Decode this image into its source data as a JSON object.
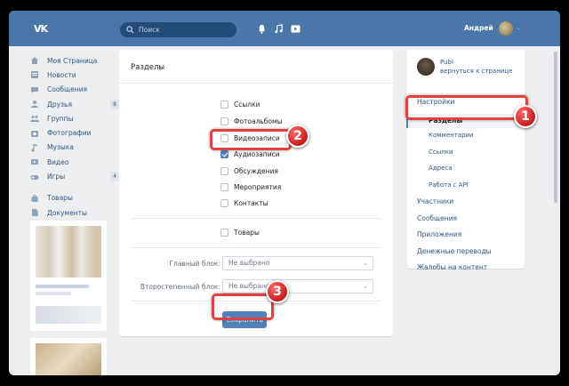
{
  "topbar": {
    "logo_text": "VK",
    "search_placeholder": "Поиск",
    "user_name": "Андрей",
    "chevron": "⌄",
    "icons": [
      "bell-icon",
      "music-icon",
      "video-play-icon"
    ]
  },
  "leftnav": {
    "items": [
      {
        "label": "Моя Страница",
        "icon": "home-icon"
      },
      {
        "label": "Новости",
        "icon": "news-icon"
      },
      {
        "label": "Сообщения",
        "icon": "message-icon"
      },
      {
        "label": "Друзья",
        "icon": "friends-icon",
        "badge": "8"
      },
      {
        "label": "Группы",
        "icon": "groups-icon"
      },
      {
        "label": "Фотографии",
        "icon": "photo-icon"
      },
      {
        "label": "Музыка",
        "icon": "music-icon"
      },
      {
        "label": "Видео",
        "icon": "video-icon"
      },
      {
        "label": "Игры",
        "icon": "games-icon",
        "badge": "4"
      }
    ],
    "items2": [
      {
        "label": "Товары",
        "icon": "bag-icon"
      },
      {
        "label": "Документы",
        "icon": "document-icon"
      }
    ]
  },
  "main": {
    "title": "Разделы",
    "checkboxes": [
      {
        "label": "Ссылки",
        "checked": false
      },
      {
        "label": "Фотоальбомы",
        "checked": false
      },
      {
        "label": "Видеозаписи",
        "checked": false
      },
      {
        "label": "Аудиозаписи",
        "checked": true
      },
      {
        "label": "Обсуждения",
        "checked": false
      },
      {
        "label": "Мероприятия",
        "checked": false
      },
      {
        "label": "Контакты",
        "checked": false
      }
    ],
    "goods": {
      "label": "Товары",
      "checked": false
    },
    "main_block_label": "Главный блок:",
    "main_block_value": "Не выбрано",
    "secondary_block_label": "Второстепенный блок:",
    "secondary_block_value": "Не выбрано",
    "save_label": "Сохранить"
  },
  "rightpanel": {
    "group_name": "Publ",
    "back_link": "вернуться к странице",
    "settings": "Настройки",
    "sections": "Разделы",
    "comments": "Комментарии",
    "links": "Ссылки",
    "addresses": "Адреса",
    "api": "Работа с API",
    "members": "Участники",
    "messages": "Сообщения",
    "apps": "Приложения",
    "transfers": "Денежные переводы",
    "complaints": "Жалобы на контент"
  },
  "callouts": {
    "one": "1",
    "two": "2",
    "three": "3"
  },
  "colors": {
    "brand": "#4a76a8",
    "accent": "#5181b8",
    "highlight": "#e04242"
  }
}
